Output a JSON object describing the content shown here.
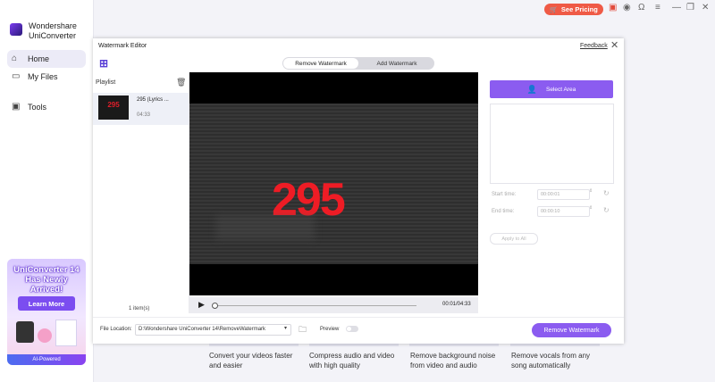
{
  "app": {
    "name_line1": "Wondershare",
    "name_line2": "UniConverter"
  },
  "sidebar": {
    "items": [
      {
        "label": "Home",
        "icon": "home-icon"
      },
      {
        "label": "My Files",
        "icon": "files-icon"
      },
      {
        "label": "Tools",
        "icon": "toolbox-icon"
      }
    ]
  },
  "promo": {
    "title_line1": "UniConverter 14",
    "title_line2": "Has Newly Arrived!",
    "button": "Learn More",
    "footer": "AI-Powered"
  },
  "topbar": {
    "pricing": "See Pricing"
  },
  "background_features": [
    {
      "line1": "Convert your videos faster",
      "line2": "and easier"
    },
    {
      "line1": "Compress audio and video",
      "line2": "with high quality"
    },
    {
      "line1": "Remove background noise",
      "line2": "from video and audio"
    },
    {
      "line1": "Remove vocals from any",
      "line2": "song automatically"
    }
  ],
  "dialog": {
    "title": "Watermark Editor",
    "feedback": "Feedback",
    "tabs": [
      "Remove Watermark",
      "Add Watermark"
    ],
    "active_tab": "Remove Watermark",
    "playlist": {
      "heading": "Playlist",
      "items": [
        {
          "name": "295 (Lyrics ...",
          "duration": "04:33",
          "thumb_text": "295"
        }
      ],
      "count": "1 item(s)"
    },
    "video": {
      "frame_text": "295",
      "time": "00:01/04:33",
      "progress": 0.004
    },
    "right_panel": {
      "select_area": "Select Area",
      "start_time_label": "Start time:",
      "start_time_value": "00:00:01",
      "end_time_label": "End time:",
      "end_time_value": "00:00:10",
      "apply_all": "Apply to All"
    },
    "footer": {
      "file_location_label": "File Location:",
      "file_location_value": "D:\\Wondershare UniConverter 14\\RemoveWatermark",
      "preview_label": "Preview",
      "preview_on": false,
      "remove_button": "Remove Watermark"
    }
  },
  "colors": {
    "accent": "#8b5cf0",
    "pricing": "#ef5a46",
    "watermark_red": "#ee1c25"
  }
}
